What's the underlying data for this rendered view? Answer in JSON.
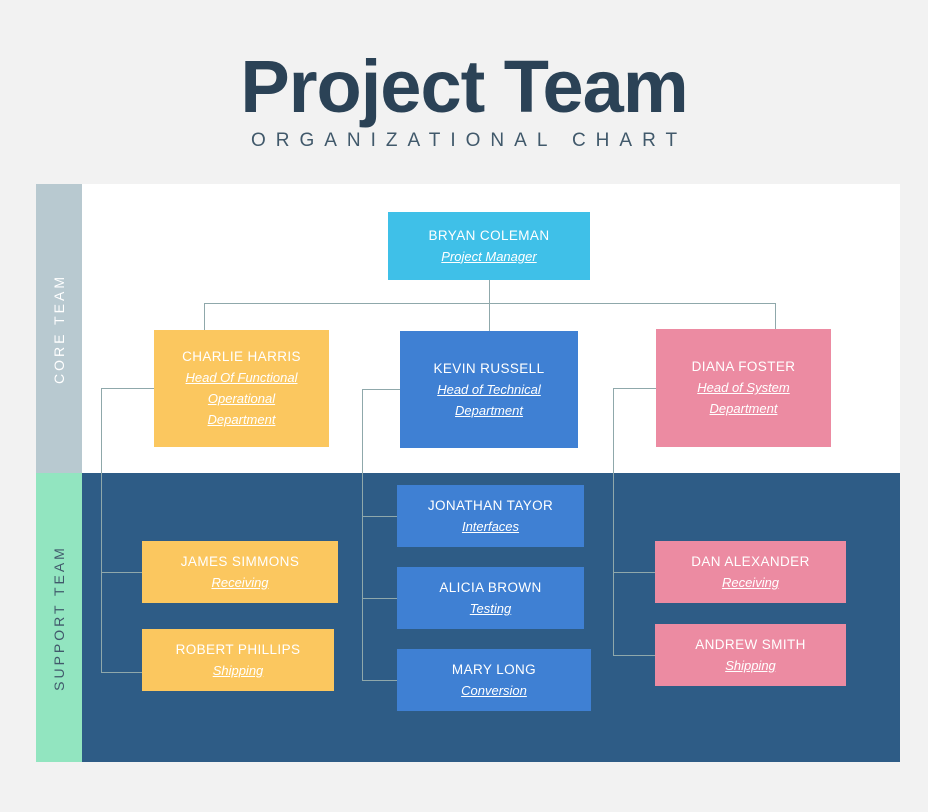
{
  "header": {
    "title": "Project Team",
    "subtitle": "ORGANIZATIONAL CHART"
  },
  "bands": {
    "core_label": "CORE TEAM",
    "support_label": "SUPPORT TEAM"
  },
  "colors": {
    "title": "#2b4256",
    "cyan": "#3fc0e8",
    "yellow": "#fbc75f",
    "blue": "#3f80d3",
    "pink": "#ec8ba2",
    "support_bg": "#2e5c86",
    "core_band": "#b8c9d0",
    "support_band": "#92e5c0",
    "connector": "#8fa8ab"
  },
  "chart_data": {
    "type": "diagram",
    "title": "Project Team",
    "subtitle": "ORGANIZATIONAL CHART",
    "nodes": [
      {
        "id": "root",
        "name": "BRYAN COLEMAN",
        "role": "Project Manager",
        "color": "cyan",
        "band": "core"
      },
      {
        "id": "charlie",
        "name": "CHARLIE HARRIS",
        "role": "Head Of Functional Operational Department",
        "color": "yellow",
        "band": "core"
      },
      {
        "id": "kevin",
        "name": "KEVIN RUSSELL",
        "role": "Head of  Technical Department",
        "color": "blue",
        "band": "core"
      },
      {
        "id": "diana",
        "name": "DIANA FOSTER",
        "role": "Head of System Department",
        "color": "pink",
        "band": "core"
      },
      {
        "id": "jonathan",
        "name": "JONATHAN TAYOR",
        "role": "Interfaces",
        "color": "blue",
        "band": "support"
      },
      {
        "id": "alicia",
        "name": "ALICIA BROWN",
        "role": "Testing",
        "color": "blue",
        "band": "support"
      },
      {
        "id": "mary",
        "name": "MARY LONG",
        "role": "Conversion",
        "color": "blue",
        "band": "support"
      },
      {
        "id": "james",
        "name": "JAMES SIMMONS",
        "role": "Receiving",
        "color": "yellow",
        "band": "support"
      },
      {
        "id": "robert",
        "name": "ROBERT PHILLIPS",
        "role": "Shipping",
        "color": "yellow",
        "band": "support"
      },
      {
        "id": "dan",
        "name": "DAN ALEXANDER",
        "role": "Receiving",
        "color": "pink",
        "band": "support"
      },
      {
        "id": "andrew",
        "name": "ANDREW SMITH",
        "role": "Shipping",
        "color": "pink",
        "band": "support"
      }
    ],
    "edges": [
      {
        "from": "root",
        "to": "charlie"
      },
      {
        "from": "root",
        "to": "kevin"
      },
      {
        "from": "root",
        "to": "diana"
      },
      {
        "from": "charlie",
        "to": "james"
      },
      {
        "from": "charlie",
        "to": "robert"
      },
      {
        "from": "kevin",
        "to": "jonathan"
      },
      {
        "from": "kevin",
        "to": "alicia"
      },
      {
        "from": "kevin",
        "to": "mary"
      },
      {
        "from": "diana",
        "to": "dan"
      },
      {
        "from": "diana",
        "to": "andrew"
      }
    ]
  },
  "nodes": {
    "root": {
      "name": "BRYAN COLEMAN",
      "role": "Project Manager"
    },
    "charlie": {
      "name": "CHARLIE HARRIS",
      "role_l1": "Head Of Functional",
      "role_l2": "Operational",
      "role_l3": "Department"
    },
    "kevin": {
      "name": "KEVIN RUSSELL",
      "role_l1": "Head of  Technical",
      "role_l2": "Department"
    },
    "diana": {
      "name": "DIANA FOSTER",
      "role_l1": "Head of System",
      "role_l2": "Department"
    },
    "jonathan": {
      "name": "JONATHAN TAYOR",
      "role": "Interfaces"
    },
    "alicia": {
      "name": "ALICIA BROWN",
      "role": "Testing"
    },
    "mary": {
      "name": "MARY LONG",
      "role": "Conversion"
    },
    "james": {
      "name": "JAMES SIMMONS",
      "role": "Receiving"
    },
    "robert": {
      "name": "ROBERT PHILLIPS",
      "role": "Shipping"
    },
    "dan": {
      "name": "DAN ALEXANDER",
      "role": "Receiving"
    },
    "andrew": {
      "name": "ANDREW SMITH",
      "role": "Shipping"
    }
  }
}
